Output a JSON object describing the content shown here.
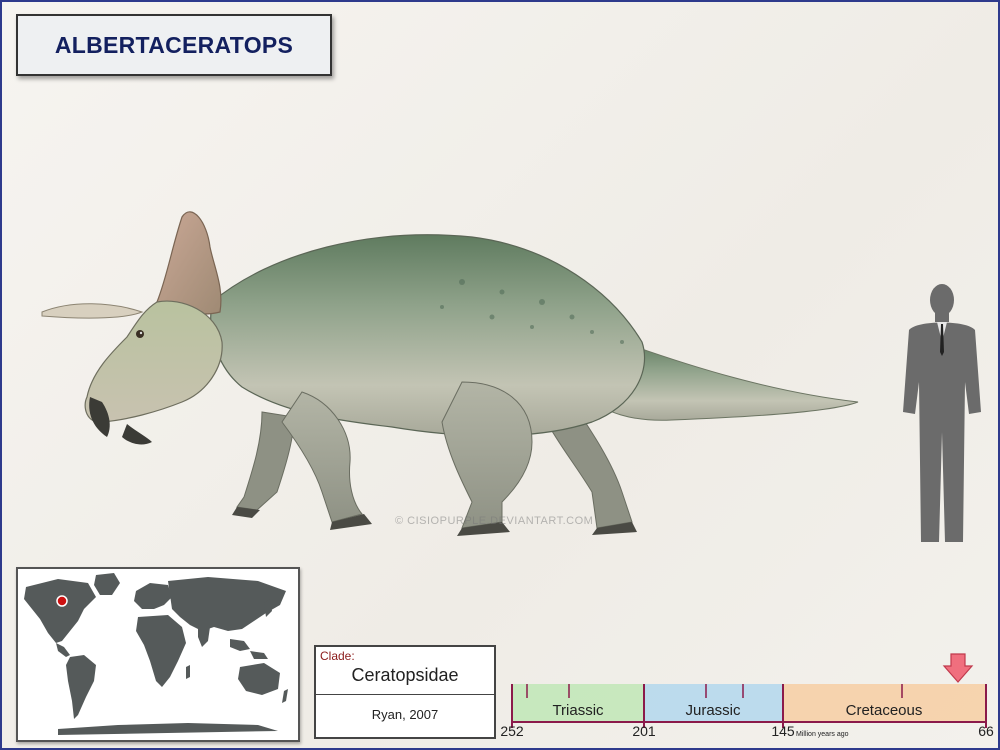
{
  "title": "ALBERTACERATOPS",
  "watermark": "© CISIOPURPLE.DEVIANTART.COM",
  "icons": {
    "dinosaur": "albertaceratops-illustration",
    "human": "human-silhouette-scale",
    "map": "world-map",
    "location": "location-marker-dot"
  },
  "colors": {
    "title_text": "#13205f",
    "frame_border": "#2e3a8c",
    "location_dot": "#cc1111",
    "triassic": "#b9e6b0",
    "jurassic": "#a9d4ee",
    "cretaceous": "#f7c99a",
    "arrow": "#f06f7e",
    "timeline_axis": "#8b1a4a"
  },
  "clade": {
    "label": "Clade:",
    "value": "Ceratopsidae"
  },
  "author": "Ryan, 2007",
  "timeline": {
    "start": "252",
    "periods": [
      {
        "name": "Triassic",
        "end": "201"
      },
      {
        "name": "Jurassic",
        "end": "145"
      },
      {
        "name": "Cretaceous",
        "end": "66"
      }
    ],
    "unit": "Million years ago",
    "marker_mya": 77
  }
}
